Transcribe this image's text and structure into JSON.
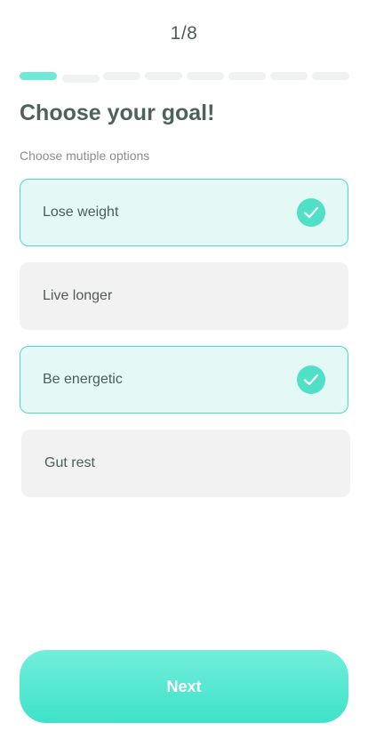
{
  "header": {
    "step_text": "1/8",
    "steps_current": 1,
    "steps_total": 8
  },
  "title": "Choose your goal!",
  "subtitle": "Choose mutiple options",
  "options": [
    {
      "label": "Lose weight",
      "selected": true,
      "icon": "check-icon"
    },
    {
      "label": "Live longer",
      "selected": false
    },
    {
      "label": "Be energetic",
      "selected": true,
      "icon": "check-icon"
    },
    {
      "label": "Gut rest",
      "selected": false
    }
  ],
  "next_button": {
    "label": "Next"
  },
  "colors": {
    "accent": "#50e0c8",
    "selected_background": "#e4f8f5",
    "selected_border": "#48dcc7",
    "unselected_background": "#f2f2f2",
    "text": "#4d5d58"
  }
}
